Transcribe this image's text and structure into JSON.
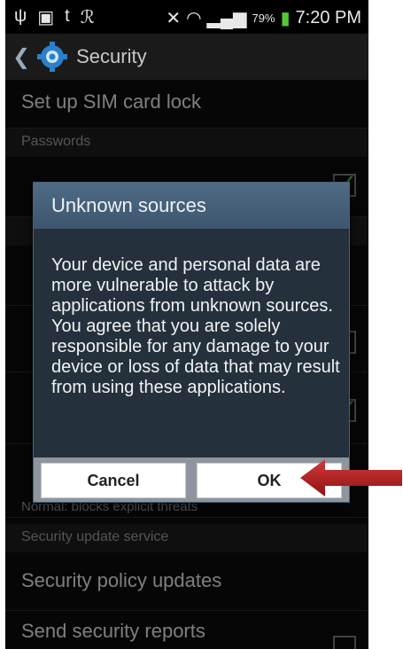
{
  "statusbar": {
    "battery": "79%",
    "time": "7:20 PM"
  },
  "actionbar": {
    "title": "Security"
  },
  "list": {
    "sim_lock": "Set up SIM card lock",
    "section_passwords": "Passwords",
    "section_update": "Security update service",
    "partial_blocks": "Normal: blocks explicit threats",
    "policy_updates": "Security policy updates",
    "send_reports": "Send security reports"
  },
  "dialog": {
    "title": "Unknown sources",
    "message": "Your device and personal data are more vulnerable to attack by applications from unknown sources. You agree that you are solely responsible for any damage to your device or loss of data that may result from using these applications.",
    "cancel_label": "Cancel",
    "ok_label": "OK"
  },
  "colors": {
    "dialog_bg": "#24313d",
    "dialog_title_bg": "#4f6b85",
    "arrow": "#b01c1c",
    "check": "#55c838"
  }
}
